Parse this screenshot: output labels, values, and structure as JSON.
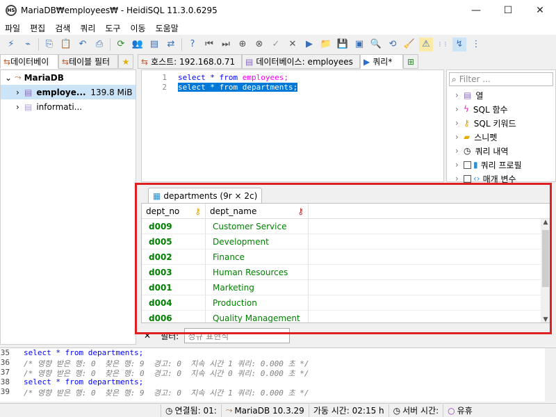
{
  "window": {
    "title": "MariaDB₩employees₩ - HeidiSQL 11.3.0.6295",
    "icon_label": "HS"
  },
  "menu": [
    "파일",
    "편집",
    "검색",
    "쿼리",
    "도구",
    "이동",
    "도움말"
  ],
  "left_tabs": [
    "데이터베이",
    "테이블 필터"
  ],
  "right_tabs": [
    {
      "label": "호스트: 192.168.0.71"
    },
    {
      "label": "데이터베이스: employees"
    },
    {
      "label": "쿼리*"
    }
  ],
  "tree": {
    "root": "MariaDB",
    "items": [
      {
        "name": "employe...",
        "size": "139.8 MiB",
        "selected": true
      },
      {
        "name": "informati...",
        "size": ""
      }
    ]
  },
  "editor": {
    "lines": [
      {
        "num": "1",
        "kw1": "select * from ",
        "tbl": "employees;",
        "selected": false
      },
      {
        "num": "2",
        "text": "select * from departments;",
        "selected": true
      }
    ]
  },
  "helpers": {
    "filter_placeholder": "Filter ...",
    "items": [
      "열",
      "SQL 함수",
      "SQL 키워드",
      "스니펫",
      "쿼리 내역",
      "쿼리 프로필",
      "매개 변수"
    ]
  },
  "result": {
    "tab_label": "departments (9r × 2c)",
    "columns": [
      "dept_no",
      "dept_name"
    ],
    "rows": [
      [
        "d009",
        "Customer Service"
      ],
      [
        "d005",
        "Development"
      ],
      [
        "d002",
        "Finance"
      ],
      [
        "d003",
        "Human Resources"
      ],
      [
        "d001",
        "Marketing"
      ],
      [
        "d004",
        "Production"
      ],
      [
        "d006",
        "Quality Management"
      ]
    ]
  },
  "filter_bar": {
    "label": "필터:",
    "placeholder": "정규 표현식"
  },
  "log": [
    {
      "num": "35",
      "text": "select * from departments;",
      "comment": false
    },
    {
      "num": "36",
      "text": "/* 영향 받은 행: 0  찾은 행: 9  경고: 0  지속 시간 1 쿼리: 0.000 초 */",
      "comment": true
    },
    {
      "num": "37",
      "text": "/* 영향 받은 행: 0  찾은 행: 0  경고: 0  지속 시간 0 쿼리: 0.000 초 */",
      "comment": true
    },
    {
      "num": "38",
      "text": "select * from departments;",
      "comment": false
    },
    {
      "num": "39",
      "text": "/* 영향 받은 행: 0  찾은 행: 9  경고: 0  지속 시간 1 쿼리: 0.000 초 */",
      "comment": true
    }
  ],
  "status": {
    "connected": "연결됨: 01:",
    "server": "MariaDB 10.3.29",
    "uptime": "가동 시간: 02:15 h",
    "server_time": "서버 시간:",
    "idle": "유휴"
  },
  "colors": {
    "keyword": "#0000ff",
    "table": "#ff00ff",
    "value": "#008000",
    "highlight": "#e02020"
  }
}
